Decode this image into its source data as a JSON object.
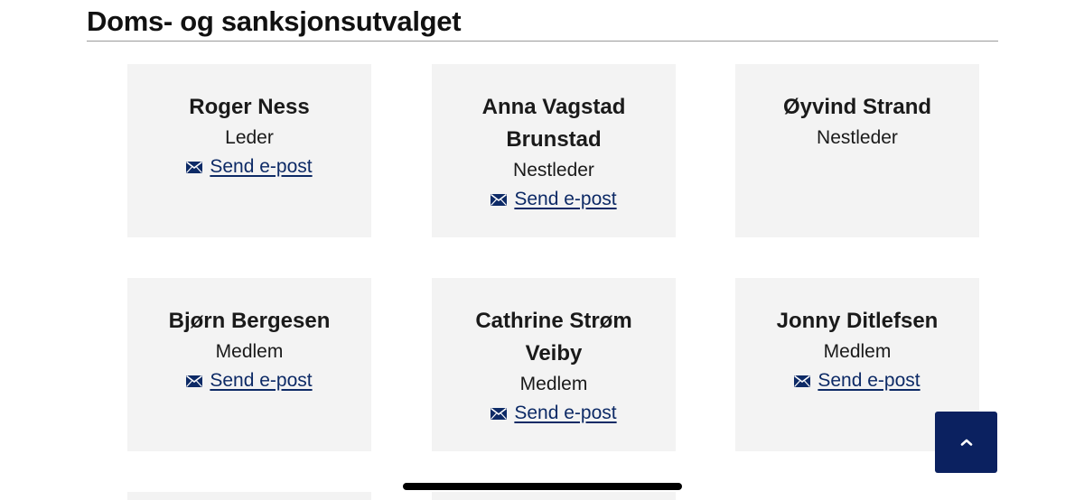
{
  "section": {
    "title": "Doms- og sanksjonsutvalget"
  },
  "members": [
    {
      "name": "Roger Ness",
      "role": "Leder",
      "email_label": "Send e-post"
    },
    {
      "name": "Anna Vagstad Brunstad",
      "role": "Nestleder",
      "email_label": "Send e-post"
    },
    {
      "name": "Øyvind Strand",
      "role": "Nestleder",
      "email_label": ""
    },
    {
      "name": "Bjørn Bergesen",
      "role": "Medlem",
      "email_label": "Send e-post"
    },
    {
      "name": "Cathrine Strøm Veiby",
      "role": "Medlem",
      "email_label": "Send e-post"
    },
    {
      "name": "Jonny Ditlefsen",
      "role": "Medlem",
      "email_label": "Send e-post"
    }
  ],
  "icons": {
    "email": "envelope-icon",
    "back_to_top": "chevron-up-icon"
  },
  "colors": {
    "card_bg": "#f3f3f3",
    "link": "#0d2a66",
    "back_to_top_bg": "#0b2160"
  }
}
